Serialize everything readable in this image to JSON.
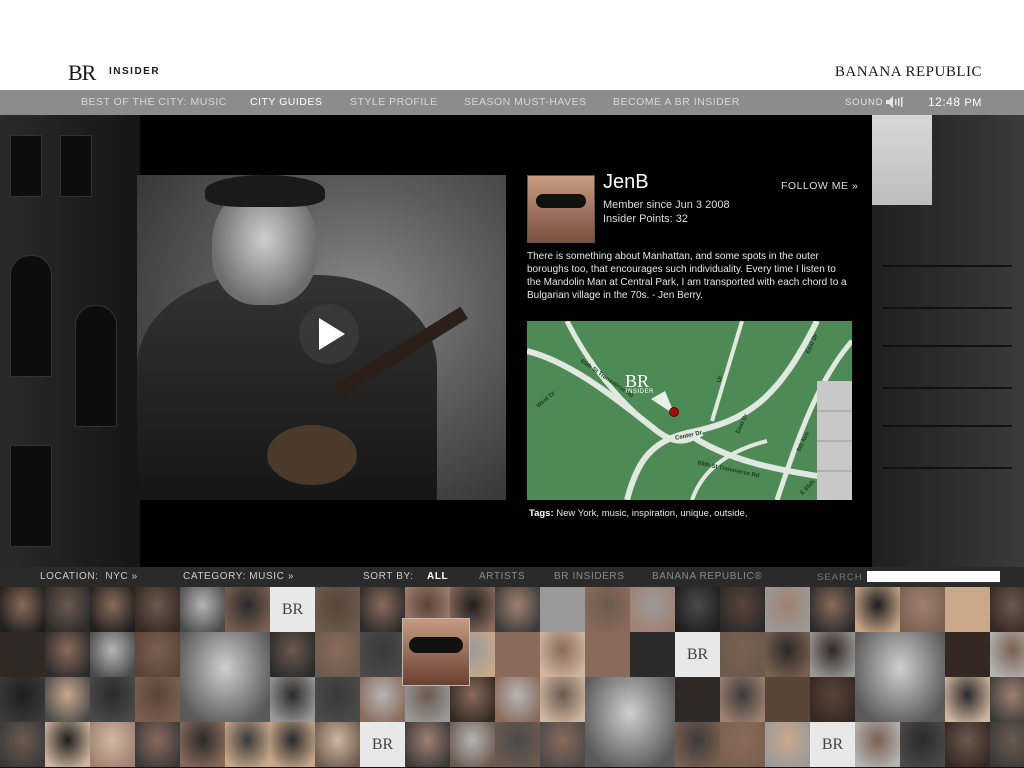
{
  "header": {
    "logo": "BR",
    "logo_sub": "INSIDER",
    "brand": "BANANA REPUBLIC"
  },
  "nav": {
    "items": [
      {
        "label": "BEST OF THE CITY: MUSIC",
        "active": false
      },
      {
        "label": "CITY GUIDES",
        "active": true
      },
      {
        "label": "STYLE PROFILE",
        "active": false
      },
      {
        "label": "SEASON MUST-HAVES",
        "active": false
      },
      {
        "label": "BECOME A BR INSIDER",
        "active": false
      }
    ],
    "sound_label": "SOUND",
    "time": "12:48",
    "ampm": "PM"
  },
  "profile": {
    "username": "JenB",
    "member_since": "Member since Jun 3 2008",
    "insider_points": "Insider Points: 32",
    "follow": "FOLLOW ME",
    "follow_arrow": "»",
    "bio": "There is something about Manhattan, and some spots in the outer boroughs too, that encourages such individuality. Every time I listen to the Mandolin Man at Central Park, I am transported with each chord to a Bulgarian village in the 70s. - Jen Berry."
  },
  "map": {
    "logo": "BR",
    "logo_sub": "INSIDER",
    "streets": [
      "65th St Transverse Rd",
      "Center Dr",
      "65th St Transverse Rd",
      "East Dr",
      "East Dr",
      "5th Ave",
      "E 65th",
      "West Dr",
      "Ur"
    ]
  },
  "tags": {
    "label": "Tags:",
    "value": "New York, music, inspiration, unique, outside,"
  },
  "filters": {
    "location_label": "LOCATION:",
    "location_value": "NYC",
    "category_label": "CATEGORY:",
    "category_value": "MUSIC",
    "arrow": "»",
    "sort_label": "SORT BY:",
    "sort_options": [
      {
        "label": "ALL",
        "active": true
      },
      {
        "label": "ARTISTS",
        "active": false
      },
      {
        "label": "BR INSIDERS",
        "active": false
      },
      {
        "label": "BANANA REPUBLIC®",
        "active": false
      }
    ],
    "search_label": "SEARCH",
    "search_value": ""
  },
  "mosaic_logo": "BR"
}
